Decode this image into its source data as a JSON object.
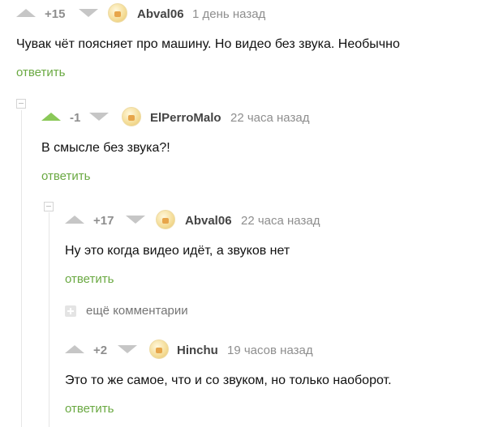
{
  "colors": {
    "accent_green": "#8ac858",
    "link_green": "#6aa942",
    "muted": "#8e8e8e",
    "thread_line": "#e6e6e6"
  },
  "icons": {
    "upvote": "triangle-up",
    "downvote": "triangle-down",
    "collapse": "minus-box",
    "expand": "plus-box"
  },
  "comments": [
    {
      "rating": "+15",
      "author": "Abval06",
      "time": "1 день назад",
      "text": "Чувак чёт поясняет про машину. Но видео без звука. Необычно",
      "reply": "ответить",
      "upvoted": false
    },
    {
      "rating": "-1",
      "author": "ElPerroMalo",
      "time": "22 часа назад",
      "text": "В смысле без звука?!",
      "reply": "ответить",
      "upvoted": true
    },
    {
      "rating": "+17",
      "author": "Abval06",
      "time": "22 часа назад",
      "text": "Ну это когда видео идёт, а звуков нет",
      "reply": "ответить",
      "upvoted": false
    },
    {
      "rating": "+2",
      "author": "Hinchu",
      "time": "19 часов назад",
      "text": "Это то же самое, что и со звуком, но только наоборот.",
      "reply": "ответить",
      "upvoted": false
    }
  ],
  "more_comments": {
    "label": "ещё комментарии"
  }
}
